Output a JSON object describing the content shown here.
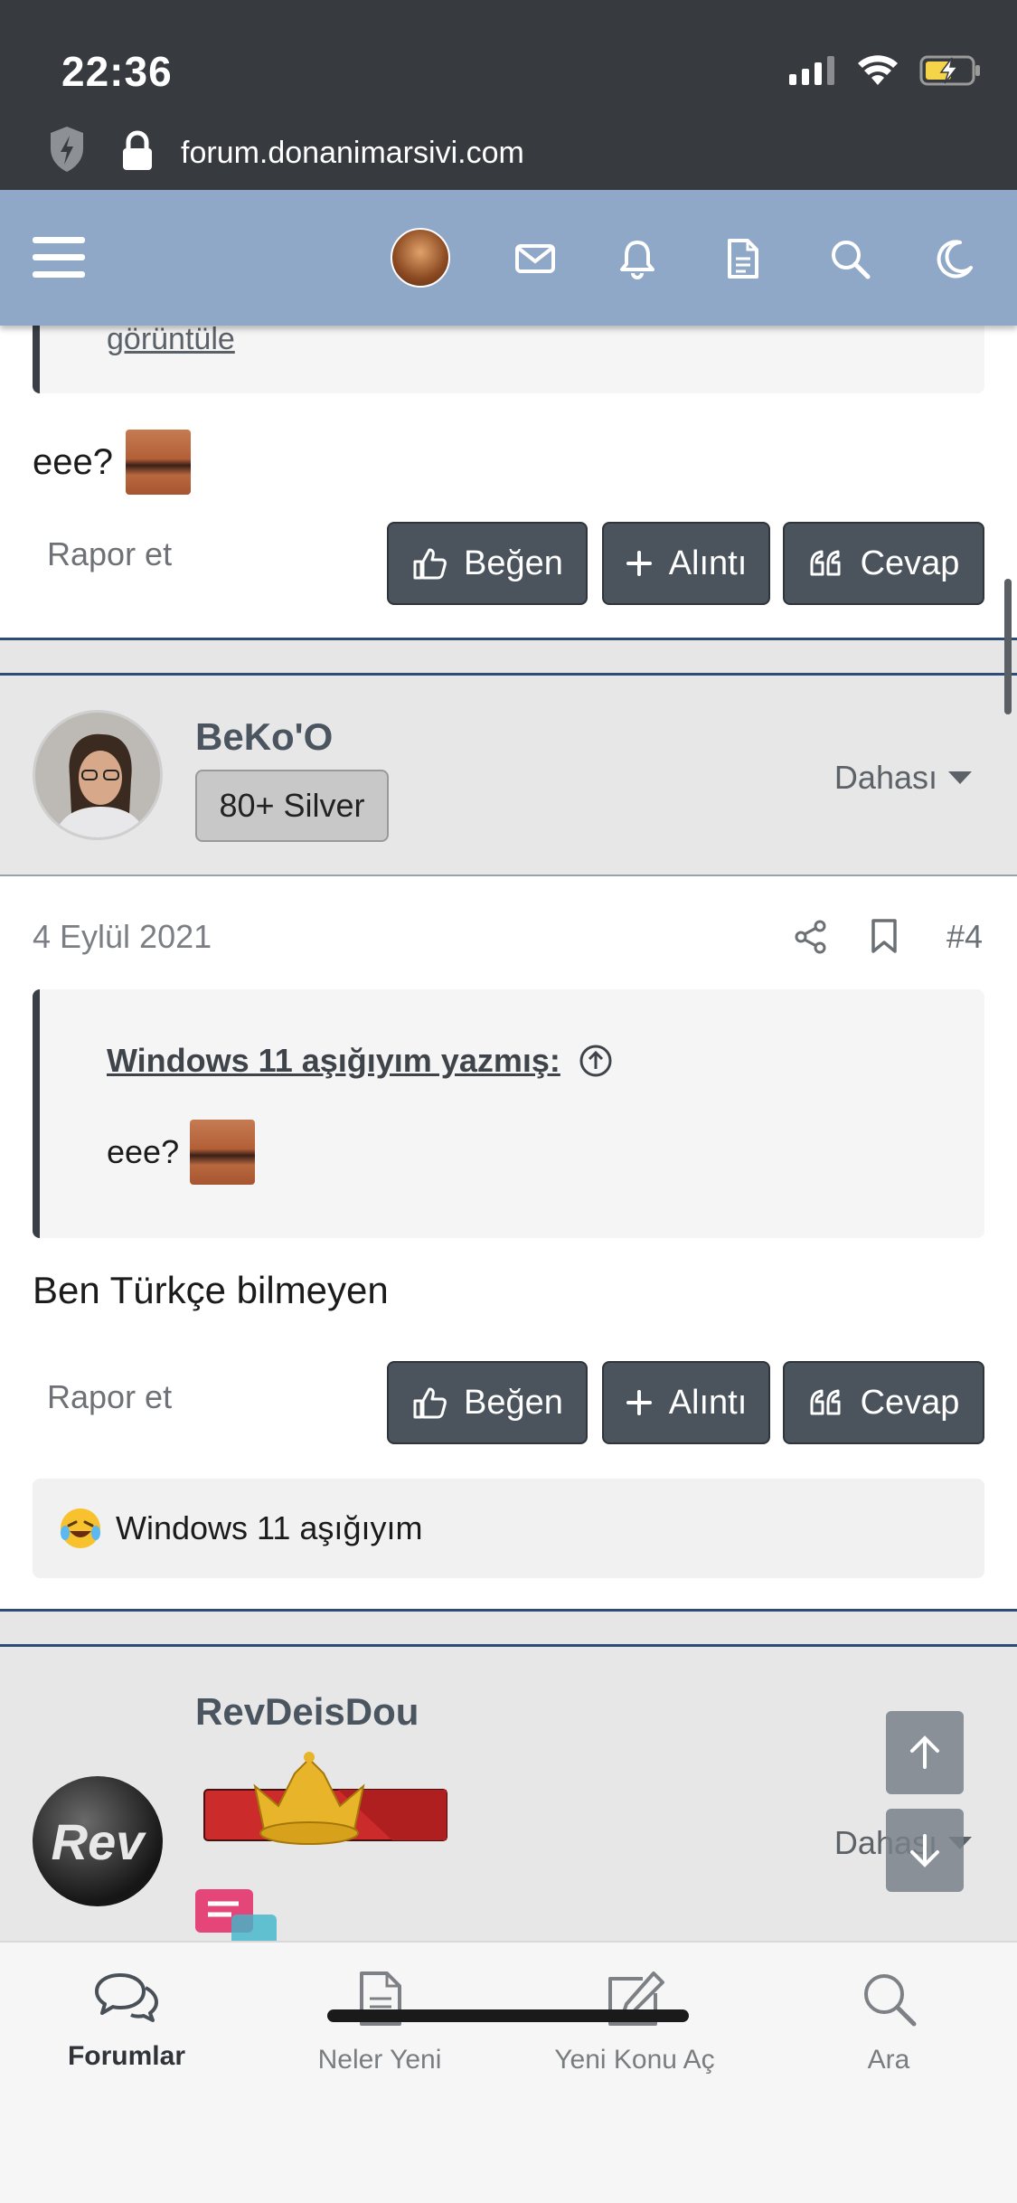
{
  "status": {
    "time": "22:36"
  },
  "browser": {
    "url": "forum.donanimarsivi.com"
  },
  "post_prev": {
    "quote_tail": "görüntüle",
    "body_text": "eee?",
    "report": "Rapor et"
  },
  "actions": {
    "like": "Beğen",
    "quote": "Alıntı",
    "reply": "Cevap"
  },
  "post4": {
    "username": "BeKo'O",
    "badge": "80+ Silver",
    "more": "Dahası",
    "date": "4 Eylül 2021",
    "post_number": "#4",
    "quote_author": "Windows 11 aşığıyım yazmış:",
    "quote_text": "eee?",
    "body_text": "Ben Türkçe bilmeyen",
    "report": "Rapor et",
    "reaction_user": "Windows 11 aşığıyım"
  },
  "post5": {
    "username": "RevDeisDou",
    "avatar_text": "Rev",
    "more": "Dahası"
  },
  "bottom_nav": {
    "forums": "Forumlar",
    "whats_new": "Neler Yeni",
    "new_thread": "Yeni Konu Aç",
    "search": "Ara"
  },
  "colors": {
    "header": "#8fa8c7",
    "button": "#4b545d",
    "divider": "#2f4c78"
  }
}
